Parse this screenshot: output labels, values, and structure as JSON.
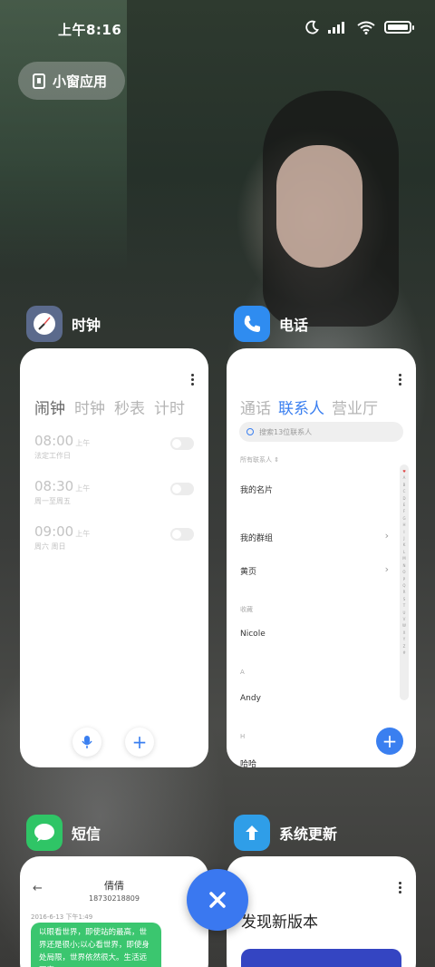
{
  "status_bar": {
    "time": "上午8:16"
  },
  "floating_windows_button": {
    "label": "小窗应用"
  },
  "apps": {
    "clock": {
      "name": "时钟",
      "tabs": [
        "闹钟",
        "时钟",
        "秒表",
        "计时"
      ],
      "alarms": [
        {
          "time": "08:00",
          "ampm": "上午",
          "repeat": "法定工作日",
          "enabled": false
        },
        {
          "time": "08:30",
          "ampm": "上午",
          "repeat": "周一至周五",
          "enabled": false
        },
        {
          "time": "09:00",
          "ampm": "上午",
          "repeat": "周六 周日",
          "enabled": false
        }
      ]
    },
    "phone": {
      "name": "电话",
      "tabs": [
        "通话",
        "联系人",
        "营业厅"
      ],
      "search_placeholder": "搜索13位联系人",
      "filter_label": "所有联系人",
      "my_card": "我的名片",
      "my_groups": "我的群组",
      "yellow_pages": "黄页",
      "favorites_header": "收藏",
      "favorite_contact": "Nicole",
      "section_a": "A",
      "contact_a": "Andy",
      "section_h": "H",
      "contact_h": "哈哈",
      "alpha_index": [
        "♥",
        "A",
        "B",
        "C",
        "D",
        "E",
        "F",
        "G",
        "H",
        "I",
        "J",
        "K",
        "L",
        "M",
        "N",
        "O",
        "P",
        "Q",
        "R",
        "S",
        "T",
        "U",
        "V",
        "W",
        "X",
        "Y",
        "Z",
        "#"
      ]
    },
    "messages": {
      "name": "短信",
      "contact_name": "倩倩",
      "contact_number": "18730218809",
      "date": "2016-6-13 下午1:49",
      "message_text": "以眼看世界，即使站的最高，世界还是很小;以心看世界，即使身处局限，世界依然很大。生活远不完"
    },
    "system_update": {
      "name": "系统更新",
      "title": "发现新版本"
    }
  },
  "colors": {
    "accent_blue": "#3a7ff0",
    "sms_green": "#3bc66f",
    "update_blue": "#3445c2"
  }
}
